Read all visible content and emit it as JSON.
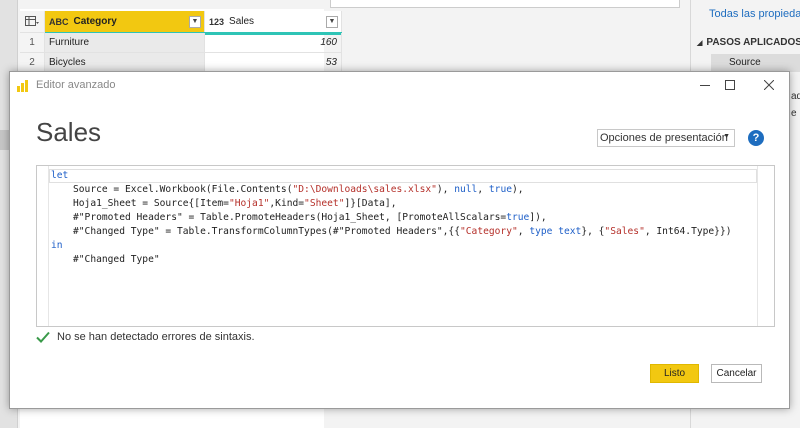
{
  "background": {
    "grid": {
      "columns": [
        {
          "type_icon": "ABC",
          "name": "Category"
        },
        {
          "type_icon": "123",
          "name": "Sales"
        }
      ],
      "rows": [
        {
          "index": "1",
          "category": "Furniture",
          "sales": "160"
        },
        {
          "index": "2",
          "category": "Bicycles",
          "sales": "53"
        }
      ]
    },
    "right_panel": {
      "properties_link": "Todas las propiedades",
      "steps_title": "PASOS APLICADOS",
      "steps": [
        "Source"
      ],
      "fragments": [
        "ad",
        "e"
      ]
    }
  },
  "dialog": {
    "window_title": "Editor avanzado",
    "heading": "Sales",
    "view_options_label": "Opciones de presentación",
    "help_symbol": "?",
    "code_lines": [
      [
        {
          "t": "let",
          "c": "kw"
        }
      ],
      [
        {
          "t": "Source = Excel.Workbook(File.Contents("
        },
        {
          "t": "\"D:\\Downloads\\sales.xlsx\"",
          "c": "str"
        },
        {
          "t": "), "
        },
        {
          "t": "null",
          "c": "kw"
        },
        {
          "t": ", "
        },
        {
          "t": "true",
          "c": "kw"
        },
        {
          "t": "),"
        }
      ],
      [
        {
          "t": "Hoja1_Sheet = Source{[Item="
        },
        {
          "t": "\"Hoja1\"",
          "c": "str"
        },
        {
          "t": ",Kind="
        },
        {
          "t": "\"Sheet\"",
          "c": "str"
        },
        {
          "t": "]}[Data],"
        }
      ],
      [
        {
          "t": "#\"Promoted Headers\" = Table.PromoteHeaders(Hoja1_Sheet, [PromoteAllScalars="
        },
        {
          "t": "true",
          "c": "kw"
        },
        {
          "t": "]),"
        }
      ],
      [
        {
          "t": "#\"Changed Type\" = Table.TransformColumnTypes(#\"Promoted Headers\",{{"
        },
        {
          "t": "\"Category\"",
          "c": "str"
        },
        {
          "t": ", "
        },
        {
          "t": "type text",
          "c": "kw"
        },
        {
          "t": "}, {"
        },
        {
          "t": "\"Sales\"",
          "c": "str"
        },
        {
          "t": ", Int64.Type}})"
        }
      ],
      [
        {
          "t": "in",
          "c": "kw"
        }
      ],
      [
        {
          "t": "#\"Changed Type\""
        }
      ]
    ],
    "status_text": "No se han detectado errores de sintaxis.",
    "ok_label": "Listo",
    "cancel_label": "Cancelar"
  },
  "colors": {
    "accent": "#f2c811",
    "keyword": "#1e5fc8",
    "string": "#b5302a",
    "success": "#3a9a4a"
  }
}
